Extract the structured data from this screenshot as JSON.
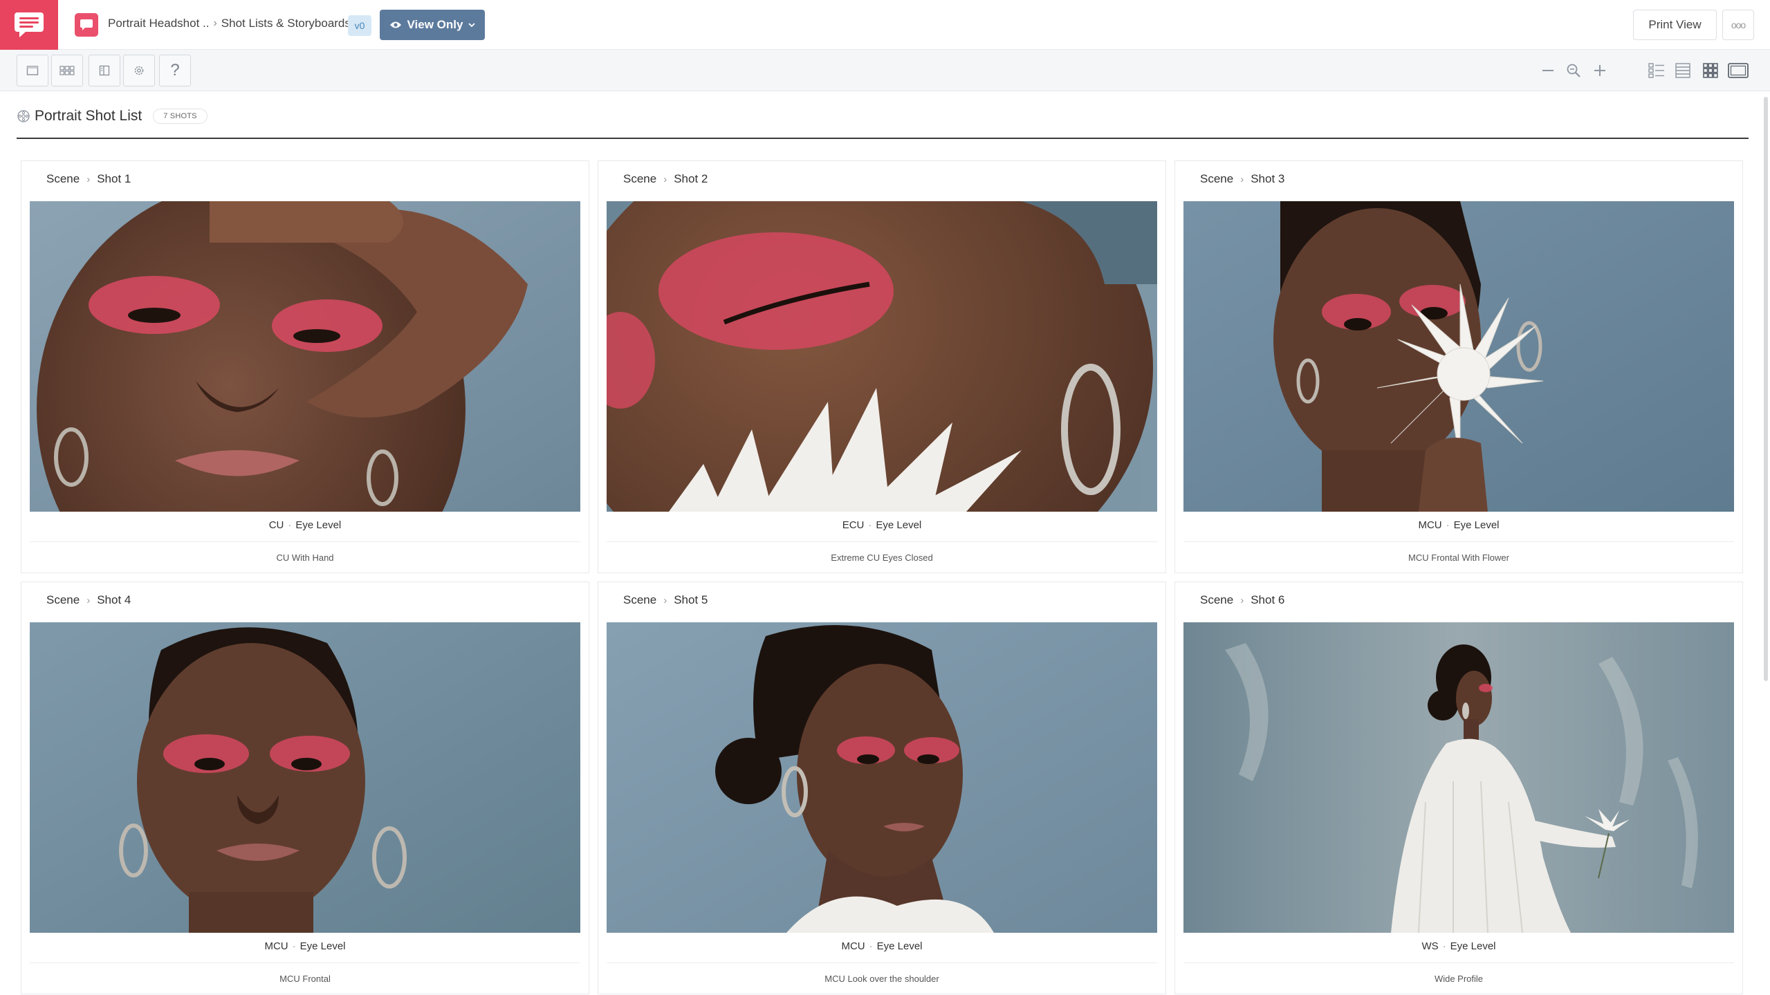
{
  "topbar": {
    "breadcrumb_project": "Portrait Headshot ..",
    "breadcrumb_section": "Shot Lists & Storyboards",
    "version": "v0",
    "view_mode": "View Only",
    "print_view": "Print View",
    "more": "ooo"
  },
  "toolbar": {
    "tools": [
      "single-frame-icon",
      "storyboard-grid-icon",
      "columns-icon",
      "settings-icon",
      "help-icon"
    ],
    "help_label": "?",
    "zoom": [
      "zoom-out-icon",
      "zoom-reset-icon",
      "zoom-in-icon"
    ],
    "layouts": [
      "list-layout-icon",
      "table-layout-icon",
      "grid-layout-icon",
      "frame-layout-icon"
    ]
  },
  "shot_list": {
    "title": "Portrait Shot List",
    "count": "7 SHOTS",
    "shots": [
      {
        "scene": "Scene",
        "shot": "Shot 1",
        "size": "CU",
        "angle": "Eye Level",
        "description": "CU With Hand"
      },
      {
        "scene": "Scene",
        "shot": "Shot 2",
        "size": "ECU",
        "angle": "Eye Level",
        "description": "Extreme CU Eyes Closed"
      },
      {
        "scene": "Scene",
        "shot": "Shot 3",
        "size": "MCU",
        "angle": "Eye Level",
        "description": "MCU Frontal With Flower"
      },
      {
        "scene": "Scene",
        "shot": "Shot 4",
        "size": "MCU",
        "angle": "Eye Level",
        "description": "MCU Frontal"
      },
      {
        "scene": "Scene",
        "shot": "Shot 5",
        "size": "MCU",
        "angle": "Eye Level",
        "description": "MCU Look over the shoulder"
      },
      {
        "scene": "Scene",
        "shot": "Shot 6",
        "size": "WS",
        "angle": "Eye Level",
        "description": "Wide Profile"
      }
    ]
  },
  "colors": {
    "brand": "#e8445f",
    "view_only_button": "#5c7a9c",
    "backdrop_blue": "#6f90a8",
    "eyeshadow_pink": "#d9475e",
    "skin": "#6b4534"
  }
}
